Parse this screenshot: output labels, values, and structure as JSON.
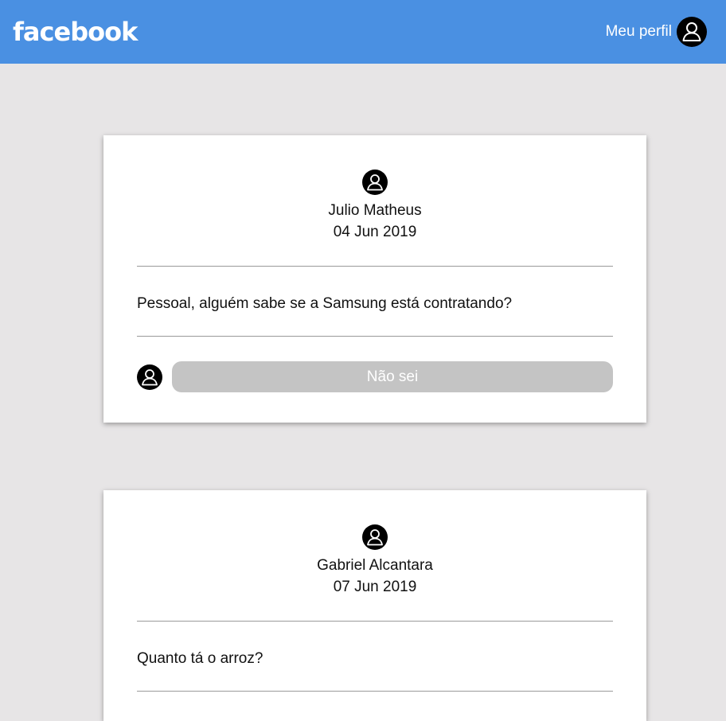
{
  "header": {
    "logo": "facebook",
    "profile_label": "Meu perfil",
    "profile_icon": "user-avatar-icon",
    "background_color": "#4a90e2"
  },
  "posts": [
    {
      "author": "Julio Matheus",
      "date": "04 Jun 2019",
      "content": "Pessoal, alguém sabe se a Samsung está contratando?",
      "reply_text": "Não sei",
      "author_icon": "user-avatar-icon"
    },
    {
      "author": "Gabriel Alcantara",
      "date": "07 Jun 2019",
      "content": "Quanto tá o arroz?",
      "author_icon": "user-avatar-icon"
    }
  ],
  "colors": {
    "page_background": "#e7e5e6",
    "card_background": "#ffffff",
    "reply_field": "#c4c4c4"
  }
}
